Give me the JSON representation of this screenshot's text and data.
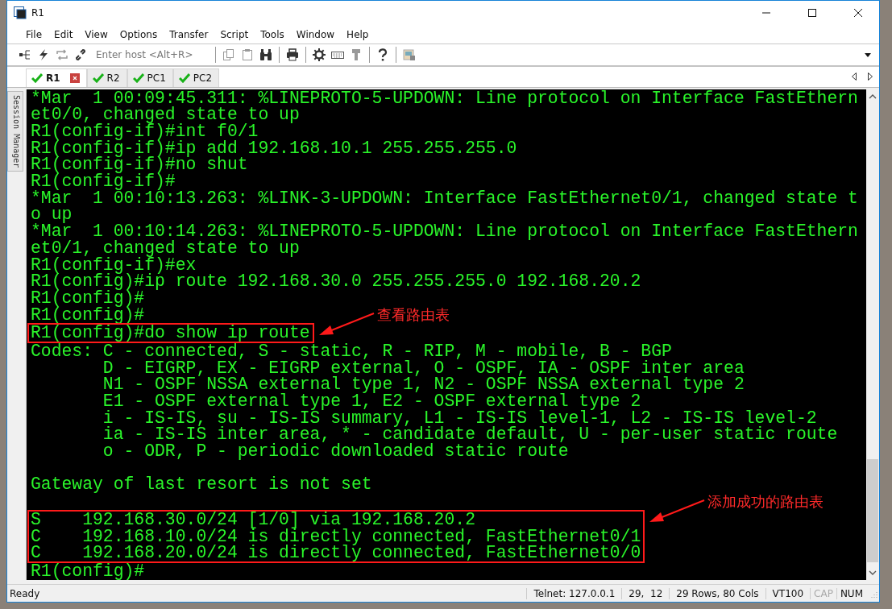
{
  "window": {
    "title": "R1"
  },
  "menu": [
    "File",
    "Edit",
    "View",
    "Options",
    "Transfer",
    "Script",
    "Tools",
    "Window",
    "Help"
  ],
  "toolbar": {
    "host_field": {
      "placeholder": "Enter host <Alt+R>"
    }
  },
  "tabs": [
    {
      "label": "R1",
      "selected": true,
      "connected": true,
      "closable": true
    },
    {
      "label": "R2",
      "selected": false,
      "connected": true,
      "closable": false
    },
    {
      "label": "PC1",
      "selected": false,
      "connected": true,
      "closable": false
    },
    {
      "label": "PC2",
      "selected": false,
      "connected": true,
      "closable": false
    }
  ],
  "session_manager": {
    "label": "Session Manager"
  },
  "terminal": {
    "blocks": [
      {
        "kind": "plain",
        "lines": [
          "*Mar  1 00:09:45.311: %LINEPROTO-5-UPDOWN: Line protocol on Interface FastEthern",
          "et0/0, changed state to up",
          "R1(config-if)#int f0/1",
          "R1(config-if)#ip add 192.168.10.1 255.255.255.0",
          "R1(config-if)#no shut",
          "R1(config-if)#",
          "*Mar  1 00:10:13.263: %LINK-3-UPDOWN: Interface FastEthernet0/1, changed state t",
          "o up",
          "*Mar  1 00:10:14.263: %LINEPROTO-5-UPDOWN: Line protocol on Interface FastEthern",
          "et0/1, changed state to up",
          "R1(config-if)#ex",
          "R1(config)#ip route 192.168.30.0 255.255.255.0 192.168.20.2",
          "R1(config)#",
          "R1(config)#"
        ]
      },
      {
        "kind": "highlight",
        "callout": "查看路由表",
        "lines": [
          "R1(config)#do show ip route"
        ]
      },
      {
        "kind": "plain",
        "lines": [
          "Codes: C - connected, S - static, R - RIP, M - mobile, B - BGP",
          "       D - EIGRP, EX - EIGRP external, O - OSPF, IA - OSPF inter area",
          "       N1 - OSPF NSSA external type 1, N2 - OSPF NSSA external type 2",
          "       E1 - OSPF external type 1, E2 - OSPF external type 2",
          "       i - IS-IS, su - IS-IS summary, L1 - IS-IS level-1, L2 - IS-IS level-2",
          "       ia - IS-IS inter area, * - candidate default, U - per-user static route",
          "       o - ODR, P - periodic downloaded static route"
        ]
      },
      {
        "kind": "blank"
      },
      {
        "kind": "plain",
        "lines": [
          "Gateway of last resort is not set"
        ]
      },
      {
        "kind": "blank"
      },
      {
        "kind": "highlight",
        "callout": "添加成功的路由表",
        "lines": [
          "S    192.168.30.0/24 [1/0] via 192.168.20.2",
          "C    192.168.10.0/24 is directly connected, FastEthernet0/1",
          "C    192.168.20.0/24 is directly connected, FastEthernet0/0"
        ]
      },
      {
        "kind": "plain",
        "lines": [
          "R1(config)#"
        ]
      }
    ]
  },
  "status_bar": {
    "message": "Ready",
    "fields": [
      "Telnet: 127.0.0.1",
      "29,  12",
      "29 Rows, 80 Cols",
      "VT100"
    ],
    "indicators": [
      {
        "label": "CAP",
        "on": false
      },
      {
        "label": "NUM",
        "on": true
      }
    ]
  }
}
